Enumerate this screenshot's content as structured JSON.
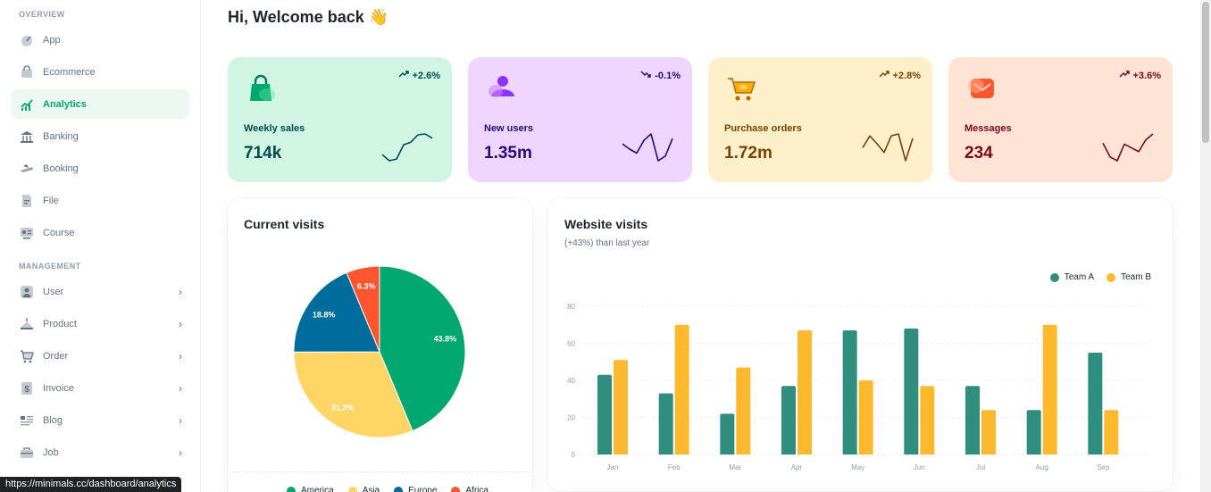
{
  "sidebar": {
    "overview_header": "OVERVIEW",
    "overview_items": [
      {
        "label": "App",
        "icon": "app-icon"
      },
      {
        "label": "Ecommerce",
        "icon": "ecommerce-icon"
      },
      {
        "label": "Analytics",
        "icon": "analytics-icon",
        "active": true
      },
      {
        "label": "Banking",
        "icon": "banking-icon"
      },
      {
        "label": "Booking",
        "icon": "booking-icon"
      },
      {
        "label": "File",
        "icon": "file-icon"
      },
      {
        "label": "Course",
        "icon": "course-icon"
      }
    ],
    "management_header": "MANAGEMENT",
    "management_items": [
      {
        "label": "User",
        "icon": "user-icon"
      },
      {
        "label": "Product",
        "icon": "product-icon"
      },
      {
        "label": "Order",
        "icon": "order-icon"
      },
      {
        "label": "Invoice",
        "icon": "invoice-icon"
      },
      {
        "label": "Blog",
        "icon": "blog-icon"
      },
      {
        "label": "Job",
        "icon": "job-icon"
      }
    ]
  },
  "status_url": "https://minimals.cc/dashboard/analytics",
  "greeting": "Hi, Welcome back 👋",
  "cards": [
    {
      "title": "Weekly sales",
      "value": "714k",
      "trend": "+2.6%",
      "trend_dir": "up",
      "icon": "shopping-bag-icon",
      "bg": "#D1F5E3",
      "text_color": "#004B50",
      "accent": "#00A76F",
      "spark": [
        22,
        8,
        12,
        45,
        51,
        68,
        70,
        60
      ]
    },
    {
      "title": "New users",
      "value": "1.35m",
      "trend": "-0.1%",
      "trend_dir": "down",
      "icon": "users-icon",
      "bg": "#EFD6FF",
      "text_color": "#27097A",
      "accent": "#8E33FF",
      "spark": [
        56,
        47,
        40,
        62,
        73,
        27,
        35,
        65
      ]
    },
    {
      "title": "Purchase orders",
      "value": "1.72m",
      "trend": "+2.8%",
      "trend_dir": "up",
      "icon": "shopping-cart-icon",
      "bg": "#FFF0CC",
      "text_color": "#7A4100",
      "accent": "#FFAB00",
      "spark": [
        40,
        70,
        50,
        28,
        70,
        75,
        7,
        64
      ]
    },
    {
      "title": "Messages",
      "value": "234",
      "trend": "+3.6%",
      "trend_dir": "up",
      "icon": "mail-icon",
      "bg": "#FFE3D5",
      "text_color": "#7A0916",
      "accent": "#FF5630",
      "spark": [
        56,
        30,
        23,
        54,
        47,
        40,
        62,
        73
      ]
    }
  ],
  "current_visits": {
    "title": "Current visits",
    "legend": [
      "America",
      "Asia",
      "Europe",
      "Africa"
    ]
  },
  "website_visits": {
    "title": "Website visits",
    "subtitle": "(+43%) than last year"
  },
  "chart_data": [
    {
      "type": "pie",
      "title": "Current visits",
      "categories": [
        "America",
        "Asia",
        "Europe",
        "Africa"
      ],
      "values": [
        43.8,
        31.3,
        18.8,
        6.3
      ],
      "value_labels": [
        "43.8%",
        "31.3%",
        "18.8%",
        "6.3%"
      ],
      "colors": [
        "#00A76F",
        "#FFD666",
        "#006C9C",
        "#FF5630"
      ]
    },
    {
      "type": "bar",
      "title": "Website visits",
      "subtitle": "(+43%) than last year",
      "categories": [
        "Jan",
        "Feb",
        "Mar",
        "Apr",
        "May",
        "Jun",
        "Jul",
        "Aug",
        "Sep"
      ],
      "series": [
        {
          "name": "Team A",
          "color": "#2F8E7E",
          "values": [
            43,
            33,
            22,
            37,
            67,
            68,
            37,
            24,
            55
          ]
        },
        {
          "name": "Team B",
          "color": "#FFB92E",
          "values": [
            51,
            70,
            47,
            67,
            40,
            37,
            24,
            70,
            24
          ]
        }
      ],
      "ylim": [
        0,
        80
      ],
      "yticks": [
        0,
        20,
        40,
        60,
        80
      ],
      "grid": true,
      "legend_position": "top-right"
    }
  ]
}
